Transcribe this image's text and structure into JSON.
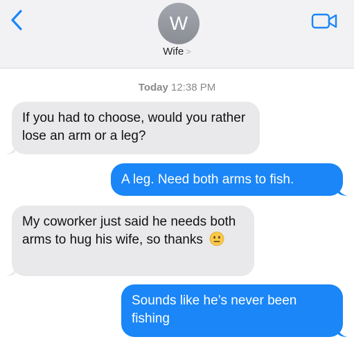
{
  "header": {
    "avatar_initial": "W",
    "contact_name": "Wife",
    "contact_chevron": ">",
    "back_icon": "chevron-left-icon",
    "video_icon": "video-camera-icon"
  },
  "timestamp": {
    "day": "Today",
    "time": "12:38 PM"
  },
  "messages": [
    {
      "direction": "incoming",
      "text": "If you had to choose, would you rather lose an arm or a leg?"
    },
    {
      "direction": "outgoing",
      "text": "A leg. Need both arms to fish."
    },
    {
      "direction": "incoming",
      "text": "My coworker just said he needs both arms to hug his wife, so thanks",
      "emoji": "neutral-face-emoji"
    },
    {
      "direction": "outgoing",
      "text": "Sounds like he’s never been fishing"
    }
  ],
  "colors": {
    "incoming_bubble": "#e9e9eb",
    "outgoing_bubble": "#1a86f7",
    "accent": "#1a86f7",
    "header_bg": "#f2f2f4"
  }
}
